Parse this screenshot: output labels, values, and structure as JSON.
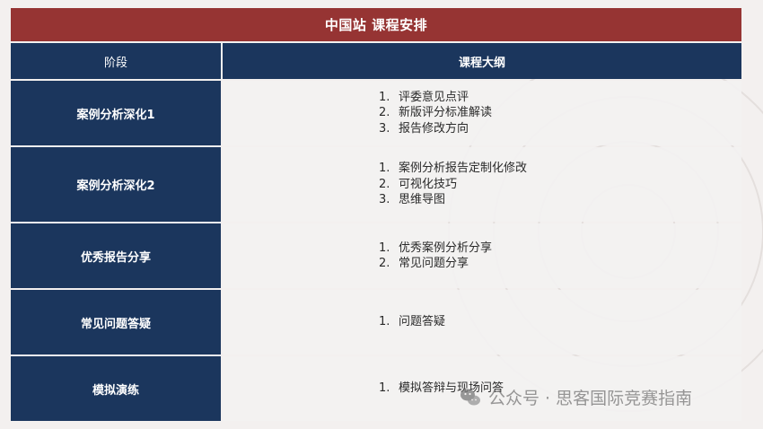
{
  "title": "中国站 课程安排",
  "headers": {
    "stage": "阶段",
    "outline": "课程大纲"
  },
  "rows": [
    {
      "stage": "案例分析深化1",
      "items": [
        {
          "num": "1.",
          "text": "评委意见点评"
        },
        {
          "num": "2.",
          "text": "新版评分标准解读"
        },
        {
          "num": "3.",
          "text": "报告修改方向"
        }
      ]
    },
    {
      "stage": "案例分析深化2",
      "items": [
        {
          "num": "1.",
          "text": "案例分析报告定制化修改"
        },
        {
          "num": "2.",
          "text": "可视化技巧"
        },
        {
          "num": "3.",
          "text": "思维导图"
        }
      ]
    },
    {
      "stage": "优秀报告分享",
      "items": [
        {
          "num": "1.",
          "text": "优秀案例分析分享"
        },
        {
          "num": "2.",
          "text": "常见问题分享"
        }
      ]
    },
    {
      "stage": "常见问题答疑",
      "items": [
        {
          "num": "1.",
          "text": "问题答疑"
        }
      ]
    },
    {
      "stage": "模拟演练",
      "items": [
        {
          "num": "1.",
          "text": "模拟答辩与现场问答"
        }
      ]
    }
  ],
  "watermark": {
    "text": "公众号 · 思客国际竞赛指南",
    "icon": "wechat-icon"
  },
  "colors": {
    "title_bg": "#963433",
    "cell_navy": "#1b365d",
    "content_bg": "#f2f1f1"
  }
}
